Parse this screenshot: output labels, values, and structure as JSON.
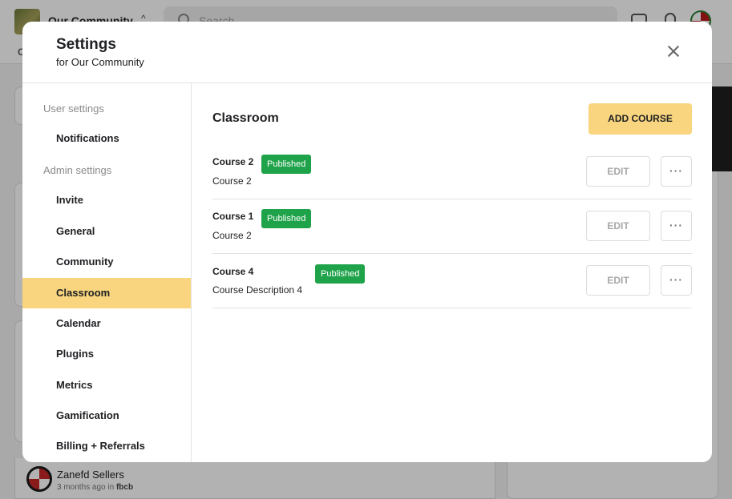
{
  "app": {
    "community_name": "Our Community",
    "search_placeholder": "Search",
    "tab_letter": "C"
  },
  "modal": {
    "title": "Settings",
    "subtitle": "for Our Community"
  },
  "sidebar": {
    "user_heading": "User settings",
    "admin_heading": "Admin settings",
    "items": [
      {
        "label": "Notifications"
      },
      {
        "label": "Invite"
      },
      {
        "label": "General"
      },
      {
        "label": "Community"
      },
      {
        "label": "Classroom",
        "active": true
      },
      {
        "label": "Calendar"
      },
      {
        "label": "Plugins"
      },
      {
        "label": "Metrics"
      },
      {
        "label": "Gamification"
      },
      {
        "label": "Billing + Referrals"
      }
    ]
  },
  "classroom": {
    "title": "Classroom",
    "add_label": "ADD COURSE",
    "edit_label": "EDIT",
    "more_label": "···",
    "courses": [
      {
        "name": "Course 2",
        "status": "Published",
        "description": "Course 2"
      },
      {
        "name": "Course 1",
        "status": "Published",
        "description": "Course 2"
      },
      {
        "name": "Course 4",
        "status": "Published",
        "description": "Course Description 4"
      }
    ]
  },
  "post": {
    "author": "Zanefd Sellers",
    "time": "3 months ago in",
    "group": "fbcb"
  },
  "colors": {
    "accent": "#f8d57e",
    "published": "#1fa34a"
  }
}
